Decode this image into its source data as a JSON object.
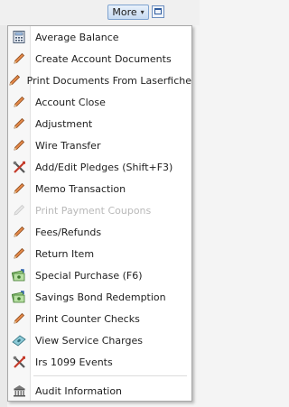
{
  "toolbar": {
    "more_label": "More",
    "more_caret": "▾"
  },
  "menu": {
    "items": [
      {
        "label": "Average Balance",
        "icon": "calculator-icon",
        "disabled": false
      },
      {
        "label": "Create Account Documents",
        "icon": "pencil-icon",
        "disabled": false
      },
      {
        "label": "Print Documents From Laserfiche",
        "icon": "pencil-icon",
        "disabled": false
      },
      {
        "label": "Account Close",
        "icon": "pencil-icon",
        "disabled": false
      },
      {
        "label": "Adjustment",
        "icon": "pencil-icon",
        "disabled": false
      },
      {
        "label": "Wire Transfer",
        "icon": "pencil-icon",
        "disabled": false
      },
      {
        "label": "Add/Edit Pledges (Shift+F3)",
        "icon": "tools-icon",
        "disabled": false
      },
      {
        "label": "Memo Transaction",
        "icon": "pencil-icon",
        "disabled": false
      },
      {
        "label": "Print Payment Coupons",
        "icon": "pencil-icon",
        "disabled": true
      },
      {
        "label": "Fees/Refunds",
        "icon": "pencil-icon",
        "disabled": false
      },
      {
        "label": "Return Item",
        "icon": "pencil-icon",
        "disabled": false
      },
      {
        "label": "Special Purchase (F6)",
        "icon": "money-stack-icon",
        "disabled": false
      },
      {
        "label": "Savings Bond Redemption",
        "icon": "money-stack-icon",
        "disabled": false
      },
      {
        "label": "Print Counter Checks",
        "icon": "pencil-icon",
        "disabled": false
      },
      {
        "label": "View Service Charges",
        "icon": "cash-icon",
        "disabled": false
      },
      {
        "label": "Irs 1099 Events",
        "icon": "tools-icon",
        "disabled": false
      },
      {
        "label": "Audit Information",
        "icon": "building-icon",
        "disabled": false
      }
    ]
  },
  "colors": {
    "menu_text": "#1e1e1e",
    "disabled_text": "#b9b9b9",
    "button_border": "#7fa3cf"
  }
}
